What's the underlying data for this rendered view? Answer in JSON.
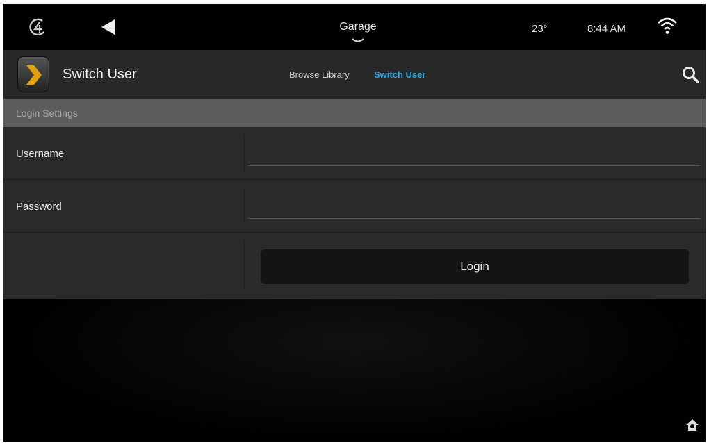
{
  "status_bar": {
    "location": "Garage",
    "temperature": "23°",
    "time": "8:44 AM",
    "icons": [
      "logo-icon",
      "back-icon",
      "chevron-down-icon",
      "wifi-icon"
    ]
  },
  "app_bar": {
    "title": "Switch User",
    "tabs": [
      {
        "label": "Browse Library",
        "active": false
      },
      {
        "label": "Switch User",
        "active": true
      }
    ],
    "accent_color": "#2aa6e6",
    "icons": [
      "plex-icon",
      "search-icon"
    ]
  },
  "section": {
    "title": "Login Settings"
  },
  "form": {
    "username_label": "Username",
    "username_value": "",
    "password_label": "Password",
    "password_value": "",
    "login_label": "Login"
  },
  "bottom": {
    "icons": [
      "home-settings-icon"
    ]
  }
}
